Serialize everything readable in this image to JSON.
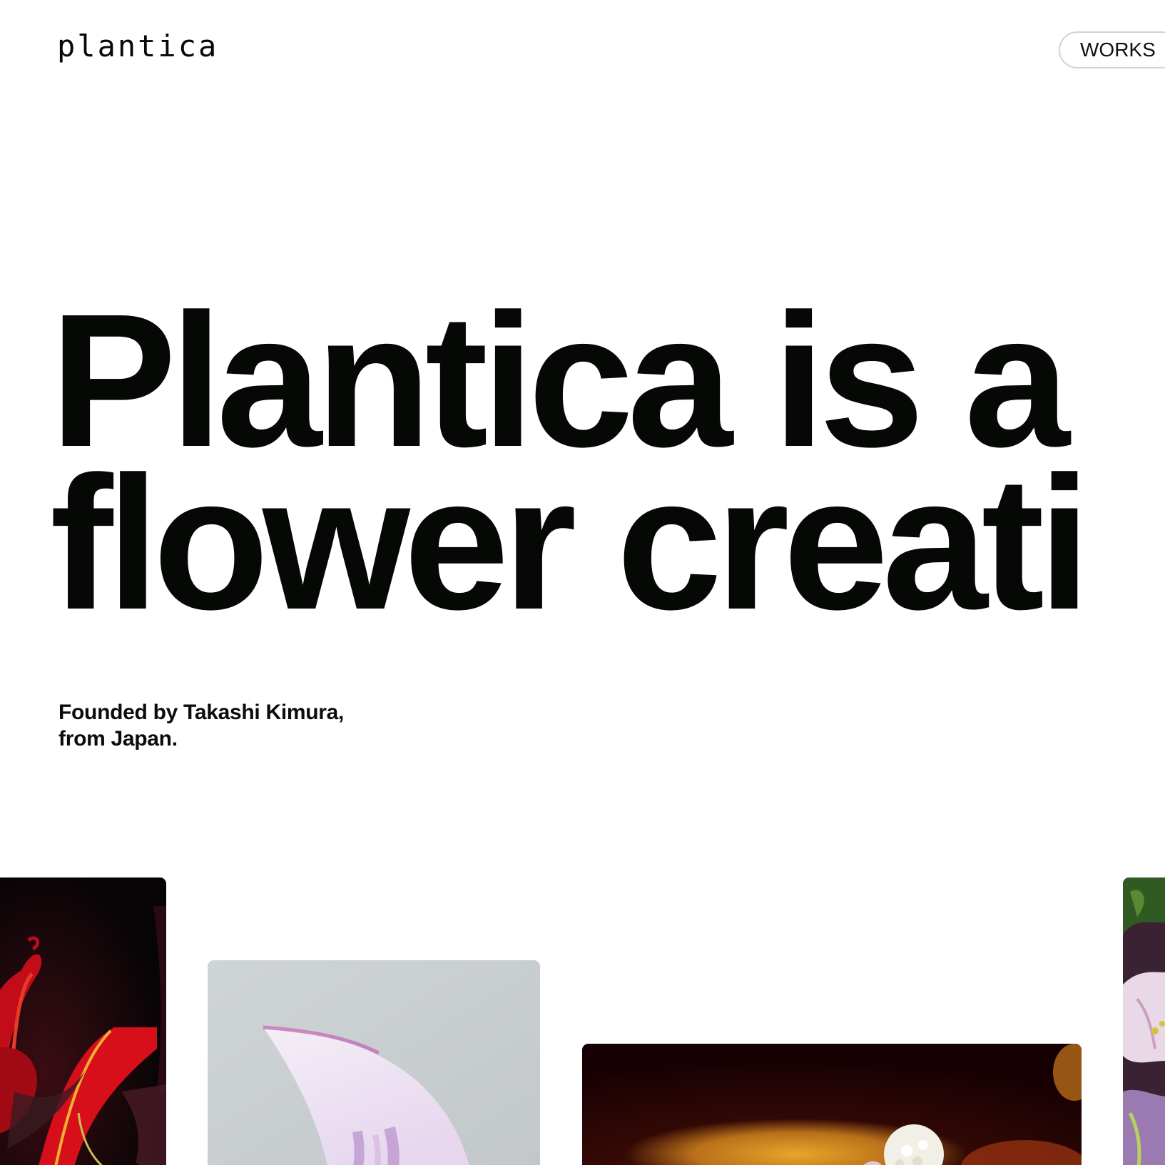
{
  "header": {
    "logo": "plantica",
    "nav_button_label": "WORKS"
  },
  "hero": {
    "line1": "Plantica is a",
    "line2": "flower creati"
  },
  "intro": {
    "line1": "Founded by Takashi Kimura,",
    "line2": "from Japan."
  },
  "gallery": {
    "items": [
      {
        "subject": "red-lily-dark-background"
      },
      {
        "subject": "pale-violet-petal-grey-background"
      },
      {
        "subject": "yellow-blur-white-flower-dark-red-background"
      },
      {
        "subject": "white-lily-purple-arrangement"
      }
    ]
  },
  "colors": {
    "background": "#ffffff",
    "text": "#050805",
    "pill_border": "#d2d2d2"
  }
}
